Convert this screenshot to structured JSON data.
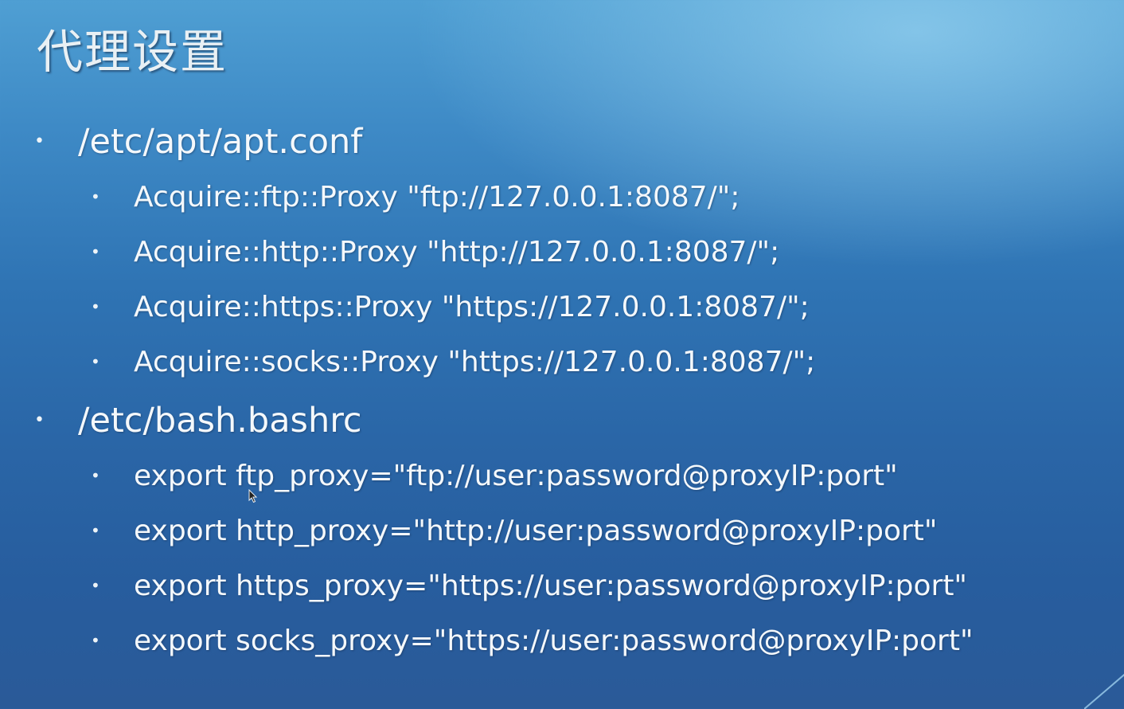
{
  "slide": {
    "title": "代理设置",
    "sections": [
      {
        "heading": "/etc/apt/apt.conf",
        "items": [
          "Acquire::ftp::Proxy \"ftp://127.0.0.1:8087/\";",
          "Acquire::http::Proxy \"http://127.0.0.1:8087/\";",
          "Acquire::https::Proxy \"https://127.0.0.1:8087/\";",
          "Acquire::socks::Proxy \"https://127.0.0.1:8087/\";"
        ]
      },
      {
        "heading": "/etc/bash.bashrc",
        "items": [
          "export ftp_proxy=\"ftp://user:password@proxyIP:port\"",
          "export http_proxy=\"http://user:password@proxyIP:port\"",
          "export https_proxy=\"https://user:password@proxyIP:port\"",
          "export socks_proxy=\"https://user:password@proxyIP:port\""
        ]
      }
    ],
    "bullet_glyph": "•"
  },
  "colors": {
    "background_top": "#4f9fd3",
    "background_bottom": "#2a5a98",
    "text": "#f4f8fb"
  }
}
